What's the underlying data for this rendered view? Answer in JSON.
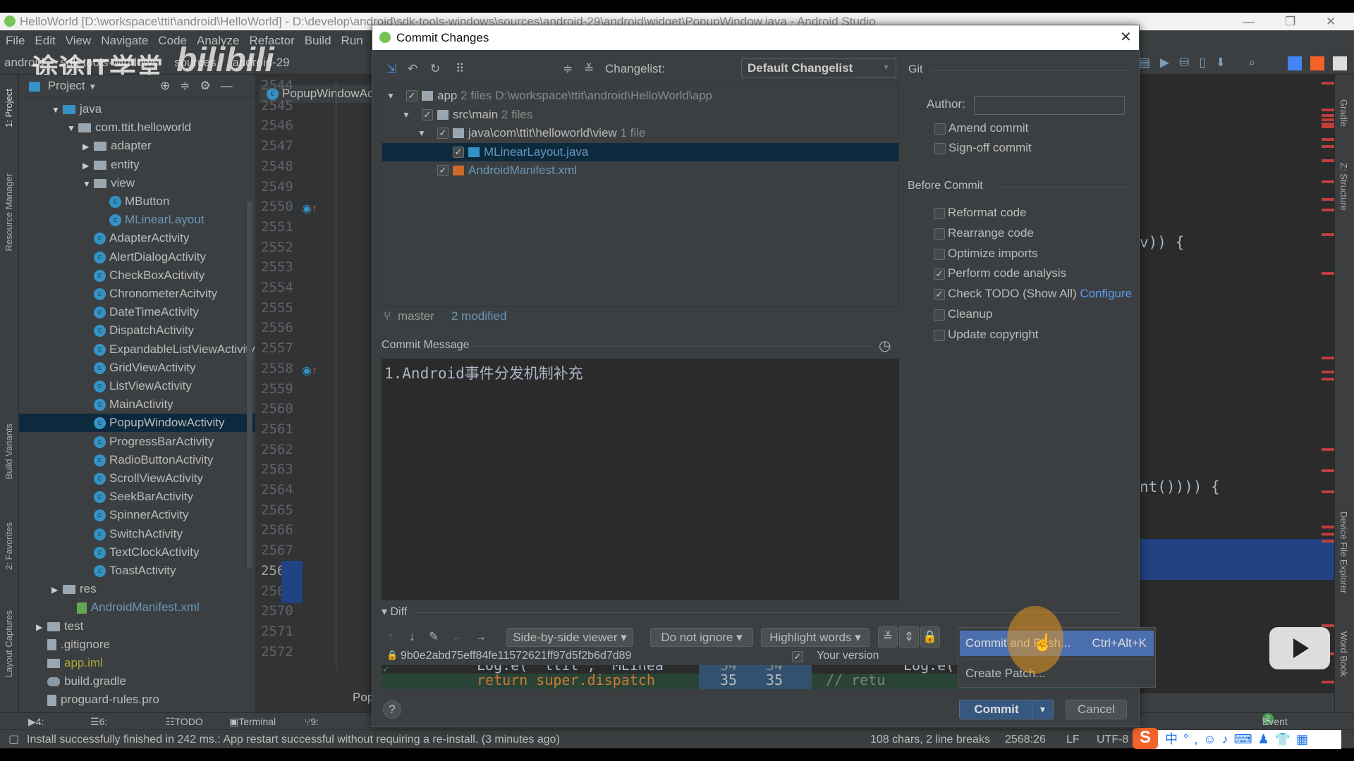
{
  "window_title": "HelloWorld [D:\\workspace\\ttit\\android\\HelloWorld] - D:\\develop\\android\\sdk-tools-windows\\sources\\android-29\\android\\widget\\PopupWindow.java - Android Studio",
  "menu": [
    "File",
    "Edit",
    "View",
    "Navigate",
    "Code",
    "Analyze",
    "Refactor",
    "Build",
    "Run"
  ],
  "breadcrumbs": [
    "android",
    "sdk-tools-windows",
    "sources",
    "android-29"
  ],
  "watermark": {
    "channel": "途途IT学堂",
    "logo": "bilibili"
  },
  "left_stripe": [
    "1: Project",
    "Resource Manager",
    "Build Variants",
    "2: Favorites",
    "Layout Captures"
  ],
  "right_stripe": [
    "Gradle",
    "Z: Structure",
    "Device File Explorer",
    "Word Book"
  ],
  "project": {
    "header": "Project",
    "tree": [
      {
        "label": "java",
        "depth": 3,
        "kind": "folder-blue",
        "arrow": "down"
      },
      {
        "label": "com.ttit.helloworld",
        "depth": 4,
        "kind": "package",
        "arrow": "down"
      },
      {
        "label": "adapter",
        "depth": 5,
        "kind": "package",
        "arrow": "right"
      },
      {
        "label": "entity",
        "depth": 5,
        "kind": "package",
        "arrow": "right"
      },
      {
        "label": "view",
        "depth": 5,
        "kind": "package",
        "arrow": "down"
      },
      {
        "label": "MButton",
        "depth": 6,
        "kind": "class"
      },
      {
        "label": "MLinearLayout",
        "depth": 6,
        "kind": "class",
        "modified": true
      },
      {
        "label": "AdapterActivity",
        "depth": 5,
        "kind": "class"
      },
      {
        "label": "AlertDialogActivity",
        "depth": 5,
        "kind": "class"
      },
      {
        "label": "CheckBoxAcitivity",
        "depth": 5,
        "kind": "class"
      },
      {
        "label": "ChronometerAcitvity",
        "depth": 5,
        "kind": "class"
      },
      {
        "label": "DateTimeActivity",
        "depth": 5,
        "kind": "class"
      },
      {
        "label": "DispatchActivity",
        "depth": 5,
        "kind": "class"
      },
      {
        "label": "ExpandableListViewActivity",
        "depth": 5,
        "kind": "class"
      },
      {
        "label": "GridViewActivity",
        "depth": 5,
        "kind": "class"
      },
      {
        "label": "ListViewActivity",
        "depth": 5,
        "kind": "class"
      },
      {
        "label": "MainActivity",
        "depth": 5,
        "kind": "class"
      },
      {
        "label": "PopupWindowActivity",
        "depth": 5,
        "kind": "class",
        "selected": true
      },
      {
        "label": "ProgressBarActivity",
        "depth": 5,
        "kind": "class"
      },
      {
        "label": "RadioButtonActivity",
        "depth": 5,
        "kind": "class"
      },
      {
        "label": "ScrollViewActivity",
        "depth": 5,
        "kind": "class"
      },
      {
        "label": "SeekBarActivity",
        "depth": 5,
        "kind": "class"
      },
      {
        "label": "SpinnerActivity",
        "depth": 5,
        "kind": "class"
      },
      {
        "label": "SwitchActivity",
        "depth": 5,
        "kind": "class"
      },
      {
        "label": "TextClockActivity",
        "depth": 5,
        "kind": "class"
      },
      {
        "label": "ToastActivity",
        "depth": 5,
        "kind": "class"
      },
      {
        "label": "res",
        "depth": 3,
        "kind": "folder",
        "arrow": "right"
      },
      {
        "label": "AndroidManifest.xml",
        "depth": 3.9,
        "kind": "manifest",
        "modified": true
      },
      {
        "label": "test",
        "depth": 2,
        "kind": "folder",
        "arrow": "right"
      },
      {
        "label": ".gitignore",
        "depth": 2,
        "kind": "file"
      },
      {
        "label": "app.iml",
        "depth": 2,
        "kind": "iml",
        "color": "#a8a837"
      },
      {
        "label": "build.gradle",
        "depth": 2,
        "kind": "gradle"
      },
      {
        "label": "proguard-rules.pro",
        "depth": 2,
        "kind": "file"
      }
    ]
  },
  "editor": {
    "tab": "PopupWindowActivity",
    "line_start": 2544,
    "line_end": 2572,
    "current_line": 2568,
    "marked_lines": [
      2550,
      2558
    ],
    "code_fragments": [
      "v)) {",
      "nt())))  {"
    ],
    "bottom_tab": "Popu"
  },
  "dialog": {
    "title": "Commit Changes",
    "changelist_label": "Changelist:",
    "changelist_value": "Default Changelist",
    "tree": [
      {
        "name": "app",
        "info": "2 files",
        "path": "D:\\workspace\\ttit\\android\\HelloWorld\\app",
        "checked": true,
        "arrow": true,
        "depth": 0
      },
      {
        "name": "src\\main",
        "info": "2 files",
        "checked": true,
        "arrow": true,
        "depth": 1
      },
      {
        "name": "java\\com\\ttit\\helloworld\\view",
        "info": "1 file",
        "checked": true,
        "arrow": true,
        "depth": 2
      },
      {
        "name": "MLinearLayout.java",
        "checked": true,
        "depth": 3,
        "selected": true,
        "kind": "java"
      },
      {
        "name": "AndroidManifest.xml",
        "checked": true,
        "depth": 2,
        "kind": "xml"
      }
    ],
    "branch": "master",
    "modified": "2 modified",
    "commit_message_label": "Commit Message",
    "commit_message": "1.Android事件分发机制补充",
    "git": {
      "section": "Git",
      "author_label": "Author:",
      "author_value": "",
      "options": [
        {
          "label": "Amend commit",
          "checked": false
        },
        {
          "label": "Sign-off commit",
          "checked": false
        }
      ]
    },
    "before_commit": {
      "section": "Before Commit",
      "options": [
        {
          "label": "Reformat code",
          "checked": false
        },
        {
          "label": "Rearrange code",
          "checked": false
        },
        {
          "label": "Optimize imports",
          "checked": false
        },
        {
          "label": "Perform code analysis",
          "checked": true
        },
        {
          "label": "Check TODO (Show All)",
          "checked": true,
          "link": "Configure"
        },
        {
          "label": "Cleanup",
          "checked": false
        },
        {
          "label": "Update copyright",
          "checked": false
        }
      ]
    },
    "diff": {
      "label": "Diff",
      "viewer": "Side-by-side viewer",
      "ignore": "Do not ignore",
      "highlight": "Highlight words",
      "hash": "9b0e2abd75eff84fe11572621ff97d5f2b6d7d89",
      "your_version": "Your version",
      "left_line1": "Log.e( \"ttit\", \"MLinea",
      "left_line2": "return super.dispatch",
      "num1": "34",
      "num2": "35",
      "right_line1": "Log.e(",
      "right_line2": "//        retu"
    },
    "help": "?",
    "commit_button": "Commit",
    "cancel_button": "Cancel",
    "popup": [
      {
        "label": "Commit and Push...",
        "shortcut": "Ctrl+Alt+K",
        "highlighted": true
      },
      {
        "label": "Create Patch...",
        "shortcut": ""
      }
    ]
  },
  "bottom_tools": [
    "4: Run",
    "6: Logcat",
    "TODO",
    "Terminal",
    "9: Version",
    "Event Log"
  ],
  "event_log_badge": "2",
  "status": {
    "message": "Install successfully finished in 242 ms.: App restart successful without requiring a re-install. (3 minutes ago)",
    "chars": "108 chars, 2 line breaks",
    "position": "2568:26",
    "line_sep": "LF",
    "encoding": "UTF-8"
  },
  "colors": {
    "accent": "#365880",
    "selection": "#0d293e",
    "popup_highlight": "#4b6eaf",
    "link": "#589df6",
    "modified": "#6897bb",
    "error_mark": "#bc3f3c"
  }
}
